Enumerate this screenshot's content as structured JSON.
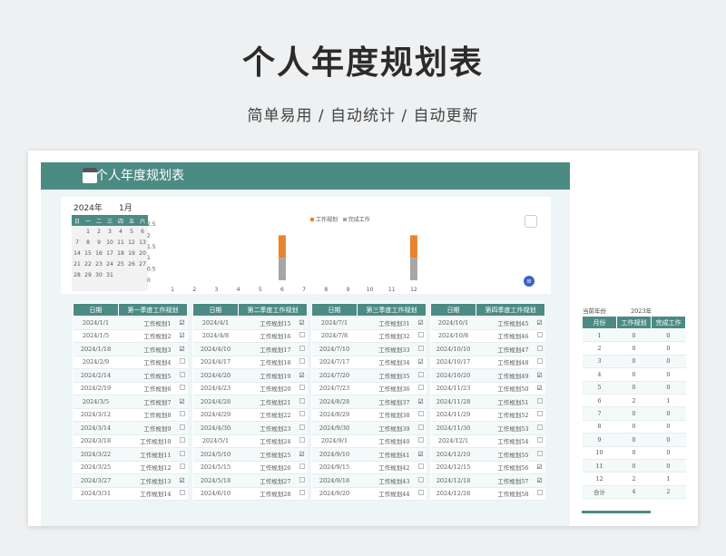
{
  "hero": {
    "title": "个人年度规划表",
    "subtitle": "简单易用  /  自动统计  /  自动更新"
  },
  "sheet": {
    "banner_title": "个人年度规划表",
    "calendar": {
      "year": "2024年",
      "month": "1月",
      "weekdays": [
        "日",
        "一",
        "二",
        "三",
        "四",
        "五",
        "六"
      ],
      "rows": [
        [
          "",
          "1",
          "2",
          "3",
          "4",
          "5",
          "6"
        ],
        [
          "7",
          "8",
          "9",
          "10",
          "11",
          "12",
          "13"
        ],
        [
          "14",
          "15",
          "16",
          "17",
          "18",
          "19",
          "20"
        ],
        [
          "21",
          "22",
          "23",
          "24",
          "25",
          "26",
          "27"
        ],
        [
          "28",
          "29",
          "30",
          "31",
          "",
          "",
          ""
        ],
        [
          "",
          "",
          "",
          "",
          "",
          "",
          ""
        ]
      ],
      "highlight": [
        "1",
        "5",
        "18"
      ]
    },
    "legend": [
      "工作规划",
      "完成工作"
    ],
    "colors": {
      "plan": "#e8832e",
      "done": "#a6a6a6",
      "accent": "#4c8b84",
      "list_btn": "#3b63c4"
    }
  },
  "chart_data": {
    "type": "bar",
    "categories": [
      "1",
      "2",
      "3",
      "4",
      "5",
      "6",
      "7",
      "8",
      "9",
      "10",
      "11",
      "12"
    ],
    "series": [
      {
        "name": "工作规划",
        "values": [
          0,
          0,
          0,
          0,
          0,
          2,
          0,
          0,
          0,
          0,
          0,
          2
        ]
      },
      {
        "name": "完成工作",
        "values": [
          0,
          0,
          0,
          0,
          0,
          1,
          0,
          0,
          0,
          0,
          0,
          1
        ]
      }
    ],
    "stacked": true,
    "yticks": [
      "0",
      "0.5",
      "1",
      "1.5",
      "2",
      "2.5"
    ],
    "ylim": [
      0,
      2.5
    ],
    "grid": false,
    "legend_position": "top"
  },
  "quarters": [
    {
      "h1": "日期",
      "h2": "第一季度工作规划",
      "rows": [
        [
          "2024/1/1",
          "工作规划1",
          "☑"
        ],
        [
          "2024/1/5",
          "工作规划2",
          "☑"
        ],
        [
          "2024/1/18",
          "工作规划3",
          "☑"
        ],
        [
          "2024/2/9",
          "工作规划4",
          ""
        ],
        [
          "2024/2/14",
          "工作规划5",
          ""
        ],
        [
          "2024/2/19",
          "工作规划6",
          ""
        ],
        [
          "2024/3/5",
          "工作规划7",
          "☑"
        ],
        [
          "2024/3/12",
          "工作规划8",
          ""
        ],
        [
          "2024/3/14",
          "工作规划9",
          ""
        ],
        [
          "2024/3/18",
          "工作规划10",
          ""
        ],
        [
          "2024/3/22",
          "工作规划11",
          ""
        ],
        [
          "2024/3/25",
          "工作规划12",
          ""
        ],
        [
          "2024/3/27",
          "工作规划13",
          "☑"
        ],
        [
          "2024/3/31",
          "工作规划14",
          ""
        ]
      ]
    },
    {
      "h1": "日期",
      "h2": "第二季度工作规划",
      "rows": [
        [
          "2024/4/1",
          "工作规划15",
          "☑"
        ],
        [
          "2024/4/8",
          "工作规划16",
          ""
        ],
        [
          "2024/4/10",
          "工作规划17",
          ""
        ],
        [
          "2024/4/17",
          "工作规划18",
          ""
        ],
        [
          "2024/4/20",
          "工作规划19",
          "☑"
        ],
        [
          "2024/4/23",
          "工作规划20",
          ""
        ],
        [
          "2024/4/28",
          "工作规划21",
          ""
        ],
        [
          "2024/4/29",
          "工作规划22",
          ""
        ],
        [
          "2024/4/30",
          "工作规划23",
          ""
        ],
        [
          "2024/5/1",
          "工作规划24",
          ""
        ],
        [
          "2024/5/10",
          "工作规划25",
          "☑"
        ],
        [
          "2024/5/15",
          "工作规划26",
          ""
        ],
        [
          "2024/5/18",
          "工作规划27",
          ""
        ],
        [
          "2024/6/10",
          "工作规划28",
          ""
        ]
      ]
    },
    {
      "h1": "日期",
      "h2": "第三季度工作规划",
      "rows": [
        [
          "2024/7/1",
          "工作规划31",
          "☑"
        ],
        [
          "2024/7/8",
          "工作规划32",
          ""
        ],
        [
          "2024/7/10",
          "工作规划33",
          ""
        ],
        [
          "2024/7/17",
          "工作规划34",
          "☑"
        ],
        [
          "2024/7/20",
          "工作规划35",
          ""
        ],
        [
          "2024/7/23",
          "工作规划36",
          ""
        ],
        [
          "2024/8/28",
          "工作规划37",
          "☑"
        ],
        [
          "2024/8/29",
          "工作规划38",
          ""
        ],
        [
          "2024/9/30",
          "工作规划39",
          ""
        ],
        [
          "2024/9/1",
          "工作规划40",
          ""
        ],
        [
          "2024/9/10",
          "工作规划41",
          "☑"
        ],
        [
          "2024/9/15",
          "工作规划42",
          ""
        ],
        [
          "2024/9/18",
          "工作规划43",
          ""
        ],
        [
          "2024/9/20",
          "工作规划44",
          ""
        ]
      ]
    },
    {
      "h1": "日期",
      "h2": "第四季度工作规划",
      "rows": [
        [
          "2024/10/1",
          "工作规划45",
          "☑"
        ],
        [
          "2024/10/8",
          "工作规划46",
          ""
        ],
        [
          "2024/10/10",
          "工作规划47",
          ""
        ],
        [
          "2024/10/17",
          "工作规划48",
          ""
        ],
        [
          "2024/10/20",
          "工作规划49",
          "☑"
        ],
        [
          "2024/11/23",
          "工作规划50",
          "☑"
        ],
        [
          "2024/11/28",
          "工作规划51",
          ""
        ],
        [
          "2024/11/29",
          "工作规划52",
          ""
        ],
        [
          "2024/11/30",
          "工作规划53",
          ""
        ],
        [
          "2024/12/1",
          "工作规划54",
          ""
        ],
        [
          "2024/12/10",
          "工作规划55",
          ""
        ],
        [
          "2024/12/15",
          "工作规划56",
          "☑"
        ],
        [
          "2024/12/18",
          "工作规划57",
          "☑"
        ],
        [
          "2024/12/28",
          "工作规划58",
          ""
        ]
      ]
    }
  ],
  "stats": {
    "label": "当前年份",
    "year": "2023年",
    "headers": [
      "月份",
      "工作规划",
      "完成工作"
    ],
    "rows": [
      [
        "1",
        "0",
        "0"
      ],
      [
        "2",
        "0",
        "0"
      ],
      [
        "3",
        "0",
        "0"
      ],
      [
        "4",
        "0",
        "0"
      ],
      [
        "5",
        "0",
        "0"
      ],
      [
        "6",
        "2",
        "1"
      ],
      [
        "7",
        "0",
        "0"
      ],
      [
        "8",
        "0",
        "0"
      ],
      [
        "9",
        "0",
        "0"
      ],
      [
        "10",
        "0",
        "0"
      ],
      [
        "11",
        "0",
        "0"
      ],
      [
        "12",
        "2",
        "1"
      ],
      [
        "合计",
        "4",
        "2"
      ]
    ]
  }
}
